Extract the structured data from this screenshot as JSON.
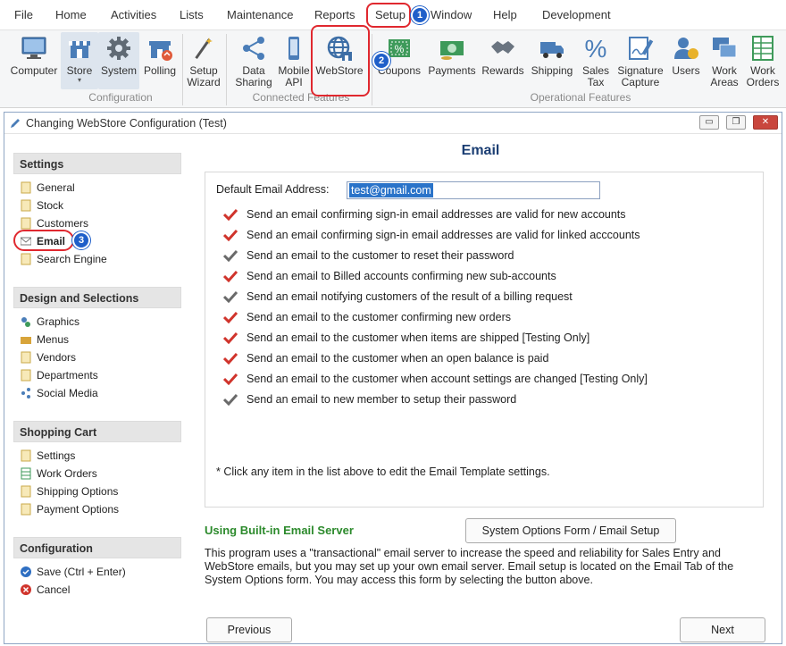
{
  "menu": [
    "File",
    "Home",
    "Activities",
    "Lists",
    "Maintenance",
    "Reports",
    "Setup",
    "Window",
    "Help",
    "Development"
  ],
  "ribbon": {
    "buttons": [
      {
        "label": "Computer",
        "icon": "computer-icon"
      },
      {
        "label": "Store",
        "icon": "store-icon"
      },
      {
        "label": "System",
        "icon": "gear-icon"
      },
      {
        "label": "Polling",
        "icon": "polling-icon"
      },
      {
        "label": "Setup Wizard",
        "icon": "wand-icon"
      },
      {
        "label": "Data Sharing",
        "icon": "share-icon"
      },
      {
        "label": "Mobile API",
        "icon": "mobile-icon"
      },
      {
        "label": "WebStore",
        "icon": "globe-store-icon"
      },
      {
        "label": "Coupons",
        "icon": "coupon-icon"
      },
      {
        "label": "Payments",
        "icon": "money-icon"
      },
      {
        "label": "Rewards",
        "icon": "handshake-icon"
      },
      {
        "label": "Shipping",
        "icon": "truck-icon"
      },
      {
        "label": "Sales Tax",
        "icon": "percent-icon"
      },
      {
        "label": "Signature Capture",
        "icon": "signature-icon"
      },
      {
        "label": "Users",
        "icon": "users-icon"
      },
      {
        "label": "Work Areas",
        "icon": "monitor-icon"
      },
      {
        "label": "Work Orders",
        "icon": "grid-icon"
      }
    ],
    "groups": [
      "Configuration",
      "Connected Features",
      "Operational Features"
    ]
  },
  "callouts": [
    "1",
    "2",
    "3"
  ],
  "window": {
    "title": "Changing WebStore Configuration  (Test)",
    "controls": {
      "minimize": "▭",
      "restore": "❐",
      "close": "✕"
    }
  },
  "sidebar": {
    "settings": {
      "title": "Settings",
      "items": [
        "General",
        "Stock",
        "Customers",
        "Email",
        "Search Engine"
      ]
    },
    "design": {
      "title": "Design and Selections",
      "items": [
        "Graphics",
        "Menus",
        "Vendors",
        "Departments",
        "Social Media"
      ]
    },
    "cart": {
      "title": "Shopping Cart",
      "items": [
        "Settings",
        "Work Orders",
        "Shipping Options",
        "Payment Options"
      ]
    },
    "config": {
      "title": "Configuration",
      "items": [
        "Save (Ctrl + Enter)",
        "Cancel"
      ]
    }
  },
  "email": {
    "heading": "Email",
    "default_label": "Default Email Address:",
    "default_value": "test@gmail.com",
    "options": [
      {
        "text": "Send an email confirming sign-in email addresses are valid for new accounts",
        "checked": true
      },
      {
        "text": "Send an email confirming sign-in email addresses are valid for linked acccounts",
        "checked": true
      },
      {
        "text": "Send an email to the customer to reset their password",
        "checked": false
      },
      {
        "text": "Send an email to Billed accounts confirming new sub-accounts",
        "checked": true
      },
      {
        "text": "Send an email notifying customers of the result of a billing request",
        "checked": false
      },
      {
        "text": "Send an email to the customer confirming new orders",
        "checked": true
      },
      {
        "text": "Send an email to the customer when items are shipped [Testing Only]",
        "checked": true
      },
      {
        "text": "Send an email to the customer when an open balance is paid",
        "checked": true
      },
      {
        "text": "Send an email to the customer when account settings are changed [Testing Only]",
        "checked": true
      },
      {
        "text": "Send an email to new member to setup their password",
        "checked": false
      }
    ],
    "footnote": "* Click any item in the list above to edit the Email Template settings."
  },
  "builtin": {
    "title": "Using Built-in Email Server",
    "button": "System Options Form / Email Setup",
    "text": "This program uses a \"transactional\" email server to increase the speed and reliability for Sales Entry and WebStore emails, but you may set up your own email server.  Email setup is located on the Email Tab of the System Options form.  You may access this form by selecting the button above."
  },
  "nav_buttons": {
    "previous": "Previous",
    "next": "Next"
  },
  "colors": {
    "accent": "#1f5fc9",
    "callout": "#e0282f",
    "heading": "#1b3e73",
    "green": "#2c8a2c",
    "check_red": "#d0342c",
    "check_gray": "#6a6a6a"
  }
}
